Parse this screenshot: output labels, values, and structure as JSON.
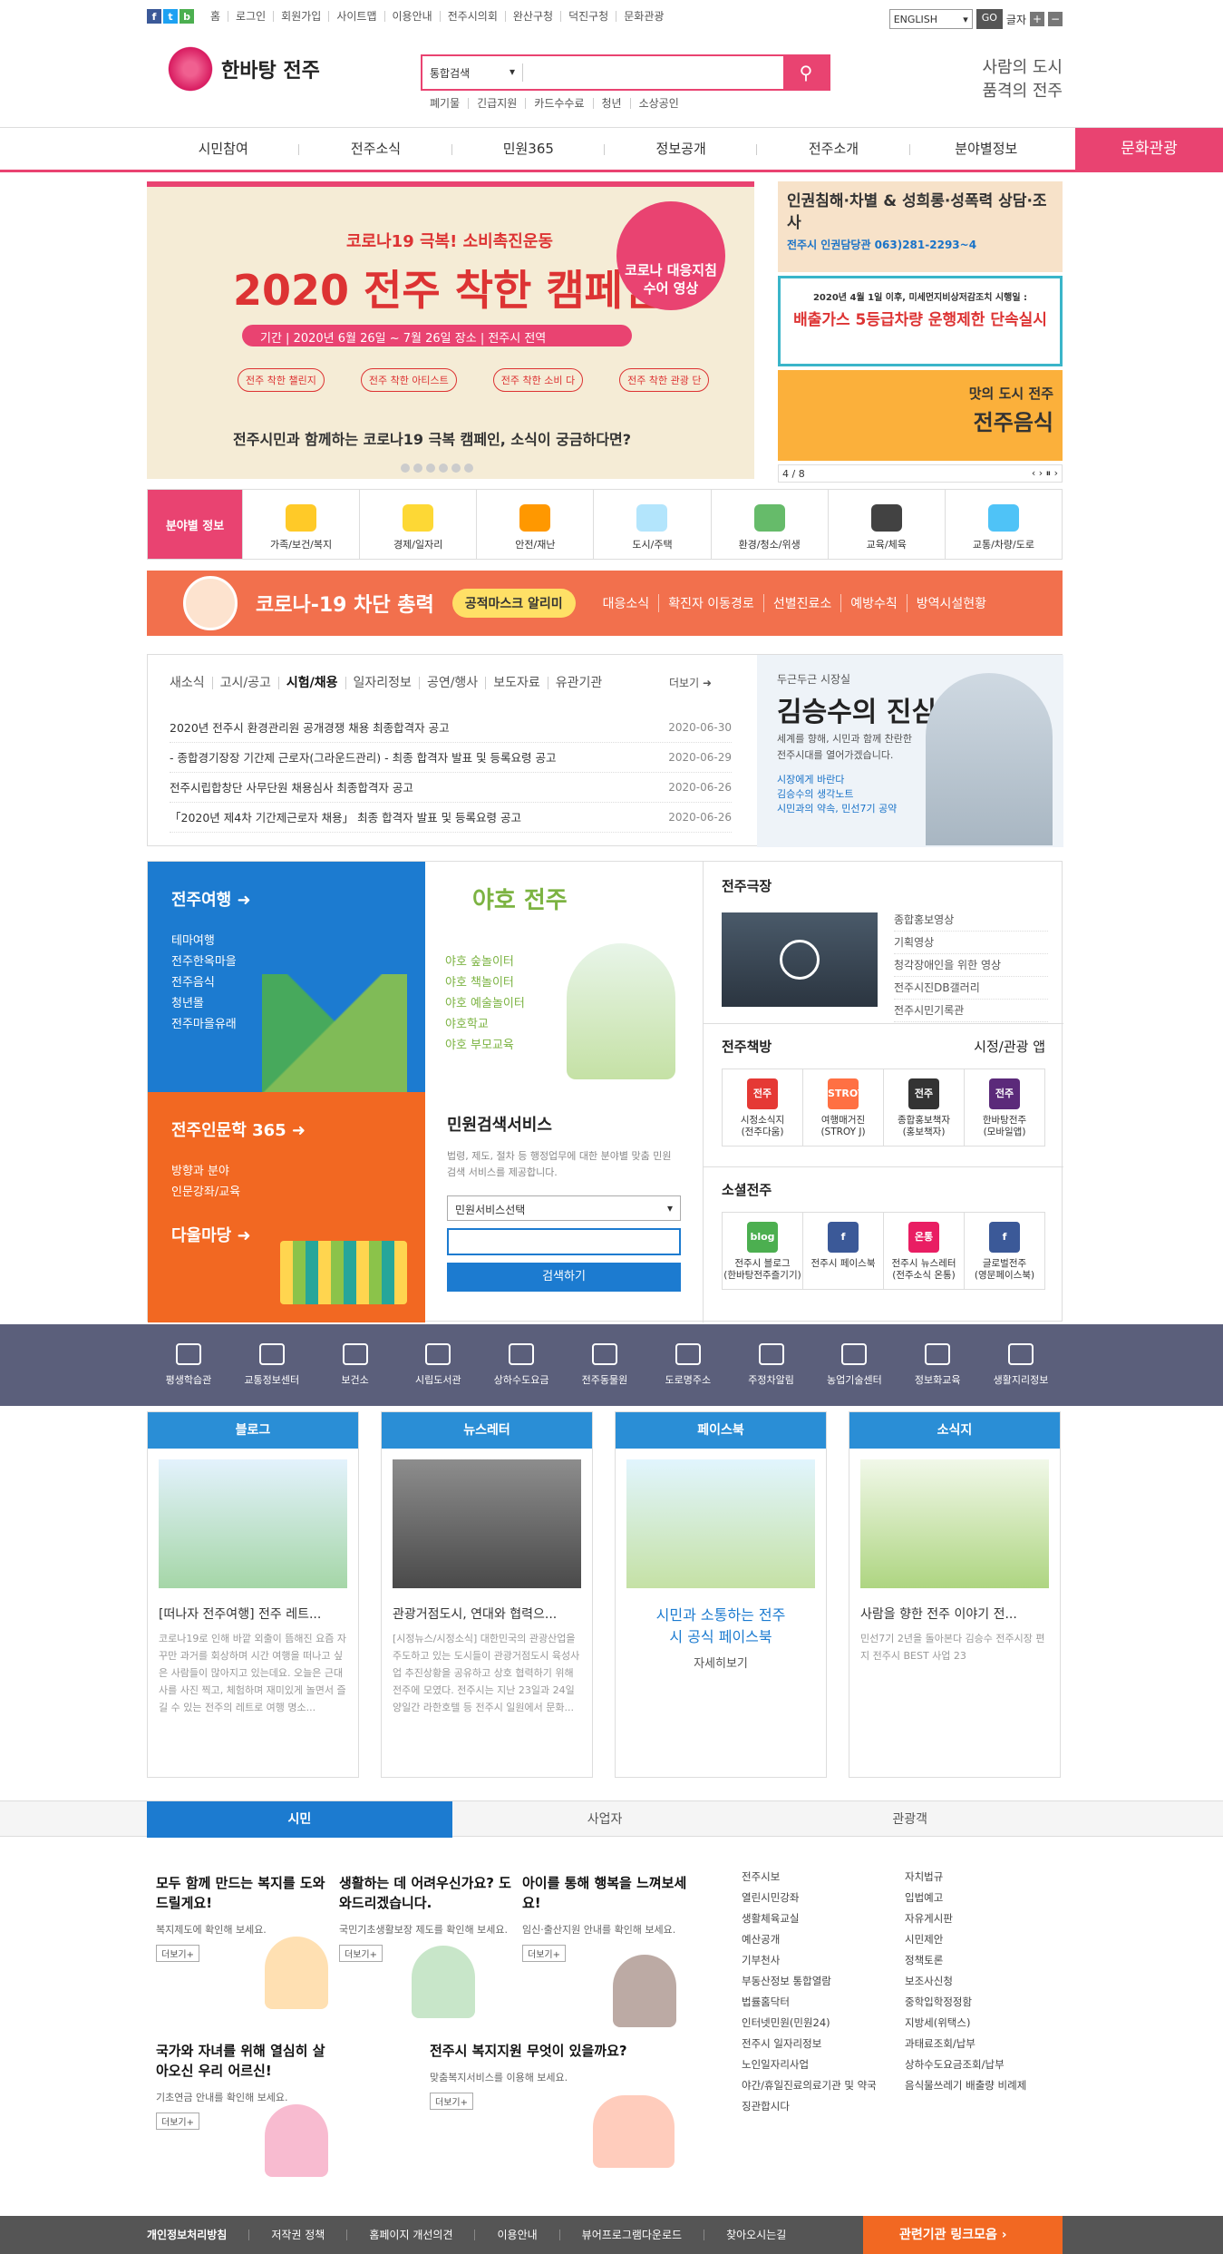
{
  "util": {
    "sns": [
      "f",
      "t",
      "b"
    ],
    "links": [
      "홈",
      "로그인",
      "회원가입",
      "사이트맵",
      "이용안내",
      "전주시의회",
      "완산구청",
      "덕진구청",
      "문화관광"
    ],
    "lang": "ENGLISH",
    "go": "GO",
    "fontsize": "글자"
  },
  "header": {
    "logo": "한바탕 전주",
    "search_category": "통합검색",
    "keywords": [
      "폐기물",
      "긴급지원",
      "카드수수료",
      "청년",
      "소상공인"
    ],
    "slogan1": "사람의 도시",
    "slogan2": "품격의 전주"
  },
  "gnb": {
    "items": [
      "시민참여",
      "전주소식",
      "민원365",
      "정보공개",
      "전주소개",
      "분야별정보"
    ],
    "culture": "문화관광"
  },
  "banner": {
    "t1": "코로나19 극복! 소비촉진운동",
    "t2": "2020 전주 착한 캠페인",
    "t3": "기간 | 2020년 6월 26일 ~ 7월 26일   장소 | 전주시 전역",
    "circle": "코로나 대응지침 수어 영상",
    "tags": [
      "전주 착한 챌린지",
      "전주 착한 아티스트",
      "전주 착한 소비 다",
      "전주 착한 관광 단"
    ],
    "t4": "전주시민과 함께하는 코로나19 극복 캠페인, 소식이 궁금하다면?"
  },
  "side": {
    "b1": "인권침해·차별 & 성희롱·성폭력 상담·조사",
    "b1s": "전주시 인권담당관 063)281-2293~4",
    "b2a": "2020년 4월 1일 이후, 미세먼지비상저감조치 시행일 :",
    "b2": "배출가스 5등급차량 운행제한 단속실시",
    "b3a": "맛의 도시 전주",
    "b3": "전주음식",
    "pager": "4 / 8"
  },
  "field": {
    "label": "분야별 정보",
    "items": [
      "가족/보건/복지",
      "경제/일자리",
      "안전/재난",
      "도시/주택",
      "환경/청소/위생",
      "교육/체육",
      "교통/차량/도로"
    ]
  },
  "corona": {
    "title": "코로나-19 차단 총력",
    "mask": "공적마스크 알리미",
    "links": [
      "대응소식",
      "확진자 이동경로",
      "선별진료소",
      "예방수칙",
      "방역시설현황"
    ]
  },
  "notice": {
    "tabs": [
      "새소식",
      "고시/공고",
      "시험/채용",
      "일자리정보",
      "공연/행사",
      "보도자료",
      "유관기관"
    ],
    "more": "더보기",
    "items": [
      {
        "t": "2020년 전주시 환경관리원 공개경쟁 채용 최종합격자 공고",
        "d": "2020-06-30"
      },
      {
        "t": "- 종합경기장장 기간제 근로자(그라운드관리) - 최종 합격자 발표 및 등록요령 공고",
        "d": "2020-06-29"
      },
      {
        "t": "전주시립합창단 사무단원 채용심사 최종합격자 공고",
        "d": "2020-06-26"
      },
      {
        "t": "「2020년 제4차 기간제근로자 채용」 최종 합격자 발표 및 등록요령 공고",
        "d": "2020-06-26"
      }
    ]
  },
  "mayor": {
    "m1": "두근두근 시장실",
    "m2": "김승수의 진심",
    "m3": "세계를 향해, 시민과 함께 찬란한 전주시대를 열어가겠습니다.",
    "links": [
      "시장에게 바란다",
      "김승수의 생각노트",
      "시민과의 약속, 민선7기 공약"
    ]
  },
  "travel": {
    "title": "전주여행",
    "items": [
      "테마여행",
      "전주한옥마을",
      "전주음식",
      "청년몰",
      "전주마을유래"
    ]
  },
  "yaho": {
    "title": "야호 전주",
    "items": [
      "야호 숲놀이터",
      "야호 책놀이터",
      "야호 예술놀이터",
      "야호학교",
      "야호 부모교육"
    ]
  },
  "inmun": {
    "title": "전주인문학 365",
    "items": [
      "방향과 분야",
      "인문강좌/교육"
    ],
    "title2": "다울마당"
  },
  "minwon": {
    "title": "민원검색서비스",
    "desc": "법령, 제도, 절차 등 행정업무에 대한 분야별 맞춤 민원 검색 서비스를 제공합니다.",
    "select": "민원서비스선택",
    "btn": "검색하기"
  },
  "theater": {
    "title": "전주극장",
    "items": [
      "종합홍보영상",
      "기획영상",
      "청각장애인을 위한 영상",
      "전주시진DB갤러리",
      "전주시민기록관"
    ]
  },
  "books": {
    "title": "전주책방",
    "app": "시정/관광 앱",
    "items": [
      {
        "n": "시정소식지",
        "s": "(전주다움)",
        "c": "#e53935",
        "i": "전주"
      },
      {
        "n": "여행매거진",
        "s": "(STROY J)",
        "c": "#ff7043",
        "i": "STROY"
      },
      {
        "n": "종합홍보책자",
        "s": "(홍보책자)",
        "c": "#333",
        "i": "전주"
      },
      {
        "n": "한바탕전주",
        "s": "(모바일앱)",
        "c": "#5b2a7a",
        "i": "전주"
      }
    ]
  },
  "social": {
    "title": "소셜전주",
    "items": [
      {
        "n": "전주시 블로그",
        "s": "(한바탕전주즐기기)",
        "c": "#4caf50",
        "i": "blog"
      },
      {
        "n": "전주시 페이스북",
        "s": "",
        "c": "#3b5998",
        "i": "f"
      },
      {
        "n": "전주시 뉴스레터",
        "s": "(전주소식 온통)",
        "c": "#e91e63",
        "i": "온통"
      },
      {
        "n": "글로벌전주",
        "s": "(영문페이스북)",
        "c": "#3b5998",
        "i": "f"
      }
    ]
  },
  "quick": [
    "평생학습관",
    "교통정보센터",
    "보건소",
    "시립도서관",
    "상하수도요금",
    "전주동물원",
    "도로명주소",
    "주정차알림",
    "농업기술센터",
    "정보화교육",
    "생활지리정보"
  ],
  "cards": [
    {
      "h": "블로그",
      "t": "[떠나자 전주여행] 전주 레트...",
      "d": "코로나19로 인해 바깥 외출이 뜸해진 요즘 자꾸만 과거를 회상하며 시간 여행을 떠나고 싶은 사람들이 많아지고 있는데요. 오늘은 근대사를 사진 찍고, 체험하며 재미있게 놀면서 즐길 수 있는 전주의 레트로 여행 명소..."
    },
    {
      "h": "뉴스레터",
      "t": "관광거점도시, 연대와 협력으...",
      "d": "[시정뉴스/시정소식] 대한민국의 관광산업을 주도하고 있는 도시들이 관광거점도시 육성사업 추진상황을 공유하고 상호 협력하기 위해 전주에 모였다. 전주시는 지난 23일과 24일 양일간 라한호텔 등 전주시 일원에서 문화..."
    },
    {
      "h": "페이스북",
      "t": "시민과 소통하는 전주시 공식 페이스북",
      "d": "자세히보기"
    },
    {
      "h": "소식지",
      "t": "사람을 향한 전주 이야기 전...",
      "d": "민선7기 2년을 돌아본다 김승수 전주시장 편지 전주시 BEST 사업 23"
    }
  ],
  "ttabs": [
    "시민",
    "사업자",
    "관광객"
  ],
  "welfare": [
    {
      "t": "모두 함께 만드는 복지를 도와드릴게요!",
      "p": "복지제도에 확인해 보세요."
    },
    {
      "t": "생활하는 데 어려우신가요? 도와드리겠습니다.",
      "p": "국민기초생활보장 제도를 확인해 보세요."
    },
    {
      "t": "아이를 통해 행복을 느껴보세요!",
      "p": "임신·출산지원 안내를 확인해 보세요."
    },
    {
      "t": "국가와 자녀를 위해 열심히 살아오신 우리 어르신!",
      "p": "기초연금 안내를 확인해 보세요."
    },
    {
      "t": "전주시 복지지원 무엇이 있을까요?",
      "p": "맞춤복지서비스를 이용해 보세요."
    }
  ],
  "more": "더보기+",
  "wlinks1": [
    "전주시보",
    "열린시민강좌",
    "생활체육교실",
    "예산공개",
    "기부천사",
    "부동산정보 통합열람",
    "법률홈닥터",
    "인터넷민원(민원24)",
    "전주시 일자리정보",
    "노인일자리사업",
    "야간/휴일진료의료기관 및 약국",
    "징관합시다"
  ],
  "wlinks2": [
    "자치법규",
    "입법예고",
    "자유게시판",
    "시민제안",
    "정책토론",
    "보조사신청",
    "중학입학정정함",
    "지방세(위택스)",
    "과태료조회/납부",
    "상하수도요금조회/납부",
    "음식물쓰레기 배출량 비례제"
  ],
  "footer": {
    "links": [
      "개인정보처리방침",
      "저작권 정책",
      "홈페이지 개선의견",
      "이용안내",
      "뷰어프로그램다운로드",
      "찾아오시는길"
    ],
    "rel": "관련기관 링크모음"
  }
}
